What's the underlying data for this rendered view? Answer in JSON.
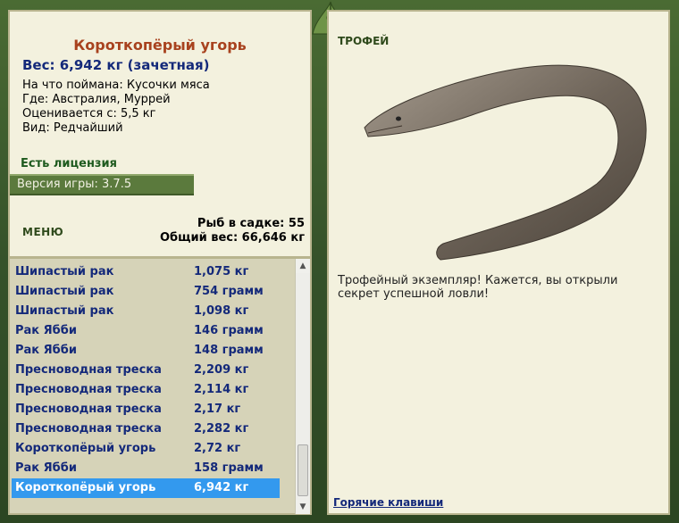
{
  "fish": {
    "title": "Короткопёрый угорь",
    "weight": "Вес: 6,942 кг (зачетная)",
    "bait": "На что поймана: Кусочки мяса",
    "location": "Где: Австралия, Муррей",
    "valued": "Оценивается с: 5,5 кг",
    "rarity": "Вид: Редчайший"
  },
  "license": "Есть лицензия",
  "version": "Версия игры: 3.7.5",
  "menu_label": "МЕНЮ",
  "stats": {
    "fish_count": "Рыб в садке: 55",
    "total_weight": "Общий вес: 66,646 кг"
  },
  "catch_list": [
    {
      "name": "Шипастый рак",
      "weight": "1,075 кг"
    },
    {
      "name": "Шипастый рак",
      "weight": "754 грамм"
    },
    {
      "name": "Шипастый рак",
      "weight": "1,098 кг"
    },
    {
      "name": "Рак Ябби",
      "weight": "146 грамм"
    },
    {
      "name": "Рак Ябби",
      "weight": "148 грамм"
    },
    {
      "name": "Пресноводная треска",
      "weight": "2,209 кг"
    },
    {
      "name": "Пресноводная треска",
      "weight": "2,114 кг"
    },
    {
      "name": "Пресноводная треска",
      "weight": "2,17 кг"
    },
    {
      "name": "Пресноводная треска",
      "weight": "2,282 кг"
    },
    {
      "name": "Короткопёрый угорь",
      "weight": "2,72 кг"
    },
    {
      "name": "Рак Ябби",
      "weight": "158 грамм"
    },
    {
      "name": "Короткопёрый угорь",
      "weight": "6,942 кг"
    }
  ],
  "selected_index": 11,
  "trophy": {
    "label": "ТРОФЕЙ",
    "text": "Трофейный экземпляр! Кажется, вы открыли секрет успешной ловли!"
  },
  "hotkeys": "Горячие клавиши",
  "colors": {
    "frame": "#3d5a2c",
    "panel": "#f3f1de",
    "list_bg": "#d6d3b8",
    "title": "#a8421e",
    "text_blue": "#14297a",
    "selected": "#3399ee"
  },
  "icons": {
    "ornament": "leaf-ornament-icon",
    "scroll_up": "scroll-up-icon",
    "scroll_down": "scroll-down-icon"
  }
}
